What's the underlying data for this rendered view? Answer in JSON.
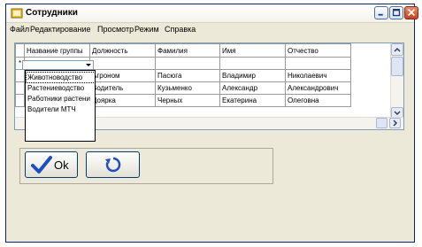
{
  "window": {
    "title": "Сотрудники"
  },
  "menu": [
    "Файл",
    "Редактирование",
    "Просмотр",
    "Режим",
    "Справка"
  ],
  "grid": {
    "columns": [
      "Название группы",
      "Должность",
      "Фамилия",
      "Имя",
      "Отчество"
    ],
    "new_row_marker": "*",
    "rows": [
      [
        "",
        "Агроном",
        "Пасюга",
        "Владимир",
        "Николаевич"
      ],
      [
        "",
        "Водитель",
        "Кузьменко",
        "Александр",
        "Александрович"
      ],
      [
        "",
        "Доярка",
        "Черных",
        "Екатерина",
        "Олеговна"
      ]
    ]
  },
  "dropdown": {
    "options": [
      "Животноводство",
      "Растениеводство",
      "Работники растени",
      "Водители МТЧ"
    ],
    "selected_index": 0
  },
  "buttons": {
    "ok_label": "Ok",
    "ok_icon": "checkmark-icon",
    "refresh_icon": "refresh-icon"
  },
  "colors": {
    "title_close": "#c9401d",
    "checkmark": "#1f4fbf",
    "refresh": "#1f4fbf"
  }
}
